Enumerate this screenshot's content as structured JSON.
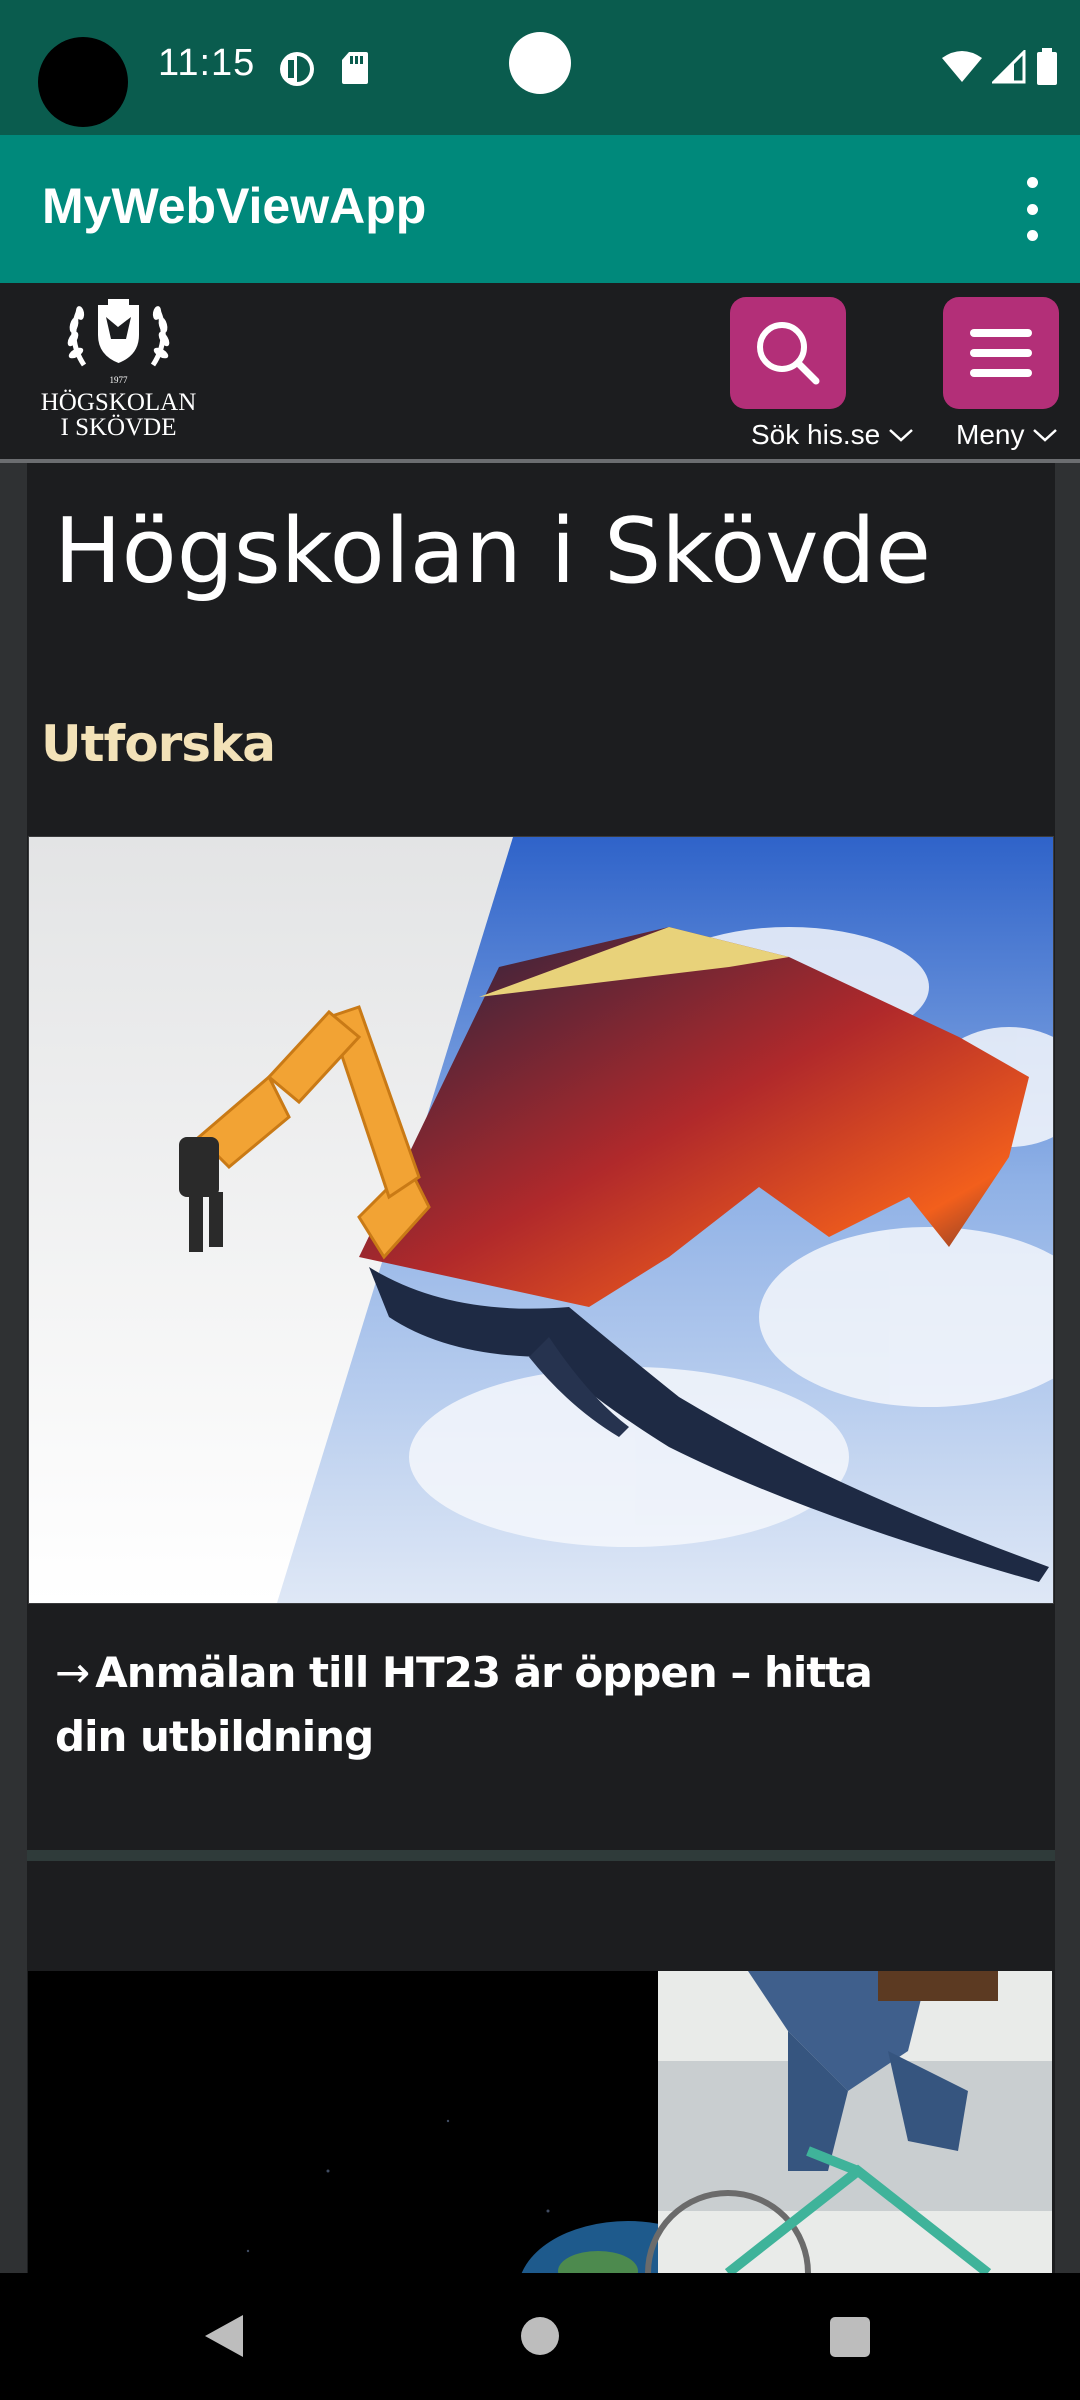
{
  "status_bar": {
    "time": "11:15",
    "icons": [
      "data-saver-icon",
      "sd-card-icon",
      "wifi-icon",
      "signal-icon",
      "battery-icon"
    ]
  },
  "app_bar": {
    "title": "MyWebViewApp",
    "overflow_icon": "more-vert-icon"
  },
  "site_header": {
    "logo": {
      "line1": "HÖGSKOLAN",
      "line2": "I SKÖVDE",
      "year": "1977"
    },
    "search_label": "Sök his.se",
    "menu_label": "Meny",
    "accent_color": "#b32f78"
  },
  "content": {
    "page_title": "Högskolan i Skövde",
    "section_heading": "Utforska",
    "hero_image": "robot-arm-and-dragon-image",
    "link_arrow": "→",
    "link_text": "Anmälan till HT23 är öppen – hitta din utbildning",
    "second_image": "earth-and-bicycle-image"
  },
  "nav_bar": {
    "icons": [
      "back-icon",
      "home-icon",
      "recents-icon"
    ]
  },
  "colors": {
    "status_bar": "#0a5c4e",
    "app_bar": "#00897b",
    "page_background": "#1c1d1f",
    "heading_gold": "#f3e2b8"
  }
}
